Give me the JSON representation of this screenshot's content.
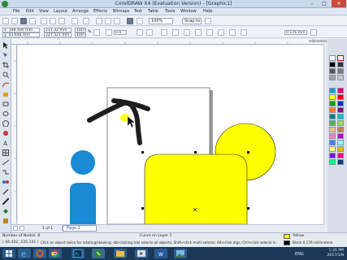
{
  "window": {
    "title": "CorelDRAW X4 (Evaluation Version) - [Graphic1]",
    "minimize": "–",
    "maximize": "□",
    "close": "✕"
  },
  "menu": [
    "File",
    "Edit",
    "View",
    "Layout",
    "Arrange",
    "Effects",
    "Bitmaps",
    "Text",
    "Table",
    "Tools",
    "Window",
    "Help"
  ],
  "toolbar": {
    "zoom": "100%",
    "snap_to": "Snap to"
  },
  "property_bar": {
    "x": "x: 194.400 mm",
    "y": "y: 43.646 mm",
    "width": "211.32 mm",
    "height": "227.521 mm",
    "scale_w": "100.0",
    "scale_h": "100.0",
    "percent": "%",
    "rotation": "0.0",
    "outline_width": "0.176 mm"
  },
  "ruler": {
    "units": "millimeters"
  },
  "page_nav": {
    "current": "1 of 1",
    "tab": "Page 1"
  },
  "status": {
    "object_count": "Number of Nodes: 8",
    "object_info": "Curve on Layer 1",
    "coords": "( 44.422, 235.141 )",
    "hint": "Click an object twice for rotating/skewing; dbl-clicking tool selects all objects; Shift+click multi-selects; Alt+click digs; Ctrl+click selects in a group",
    "fill_label": "Yellow",
    "outline_label": "Black  0.176 millimeters",
    "fill_color": "#ffff00",
    "outline_color": "#000000"
  },
  "taskbar": {
    "lang": "ENG",
    "time": "1:31 PM",
    "date": "2017/1/8"
  },
  "colors": {
    "yellow": "#ffff00",
    "blue": "#1a8ad4",
    "black": "#1e1e1e"
  }
}
